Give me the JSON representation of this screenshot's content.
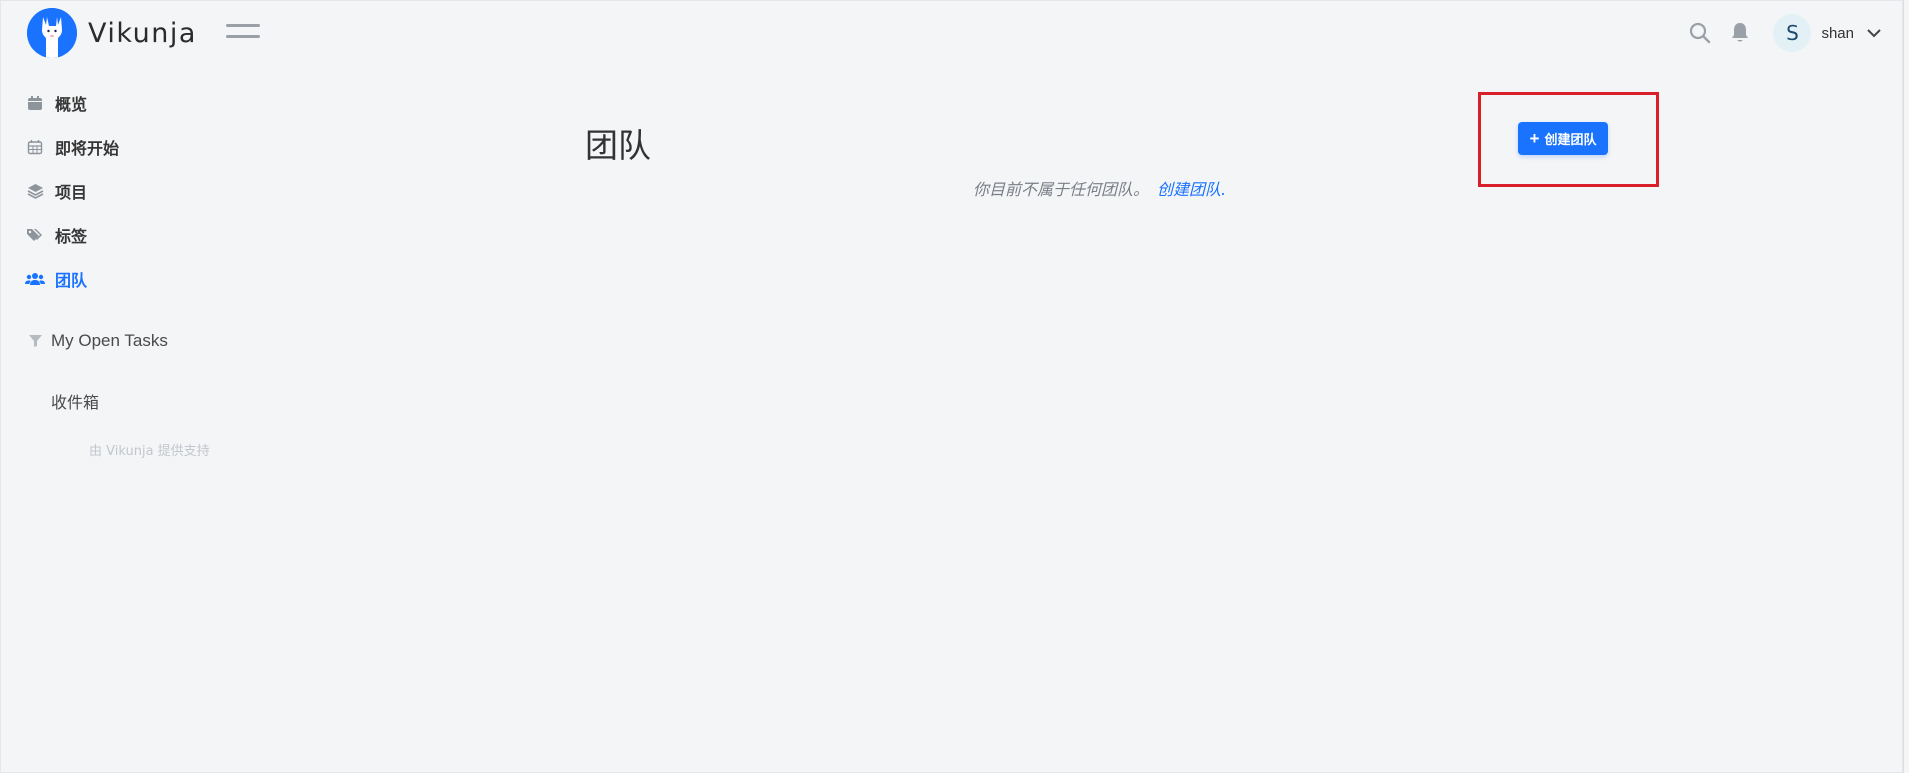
{
  "app": {
    "name": "Vikunja"
  },
  "navbar": {
    "user": {
      "initial": "S",
      "name": "shan"
    }
  },
  "sidebar": {
    "items": [
      {
        "label": "概览",
        "icon": "calendar-icon"
      },
      {
        "label": "即将开始",
        "icon": "calendar-grid-icon"
      },
      {
        "label": "项目",
        "icon": "layers-icon"
      },
      {
        "label": "标签",
        "icon": "tags-icon"
      },
      {
        "label": "团队",
        "icon": "users-icon",
        "active": true
      }
    ],
    "filter": {
      "label": "My Open Tasks",
      "icon": "filter-icon"
    },
    "inbox": {
      "label": "收件箱"
    },
    "powered_by": "由 Vikunja 提供支持"
  },
  "main": {
    "title": "团队",
    "create_button": "创建团队",
    "empty_message": "你目前不属于任何团队。",
    "empty_link": "创建团队."
  },
  "colors": {
    "accent": "#1973ff",
    "highlight": "#d9202a",
    "background": "#f4f5f7"
  }
}
